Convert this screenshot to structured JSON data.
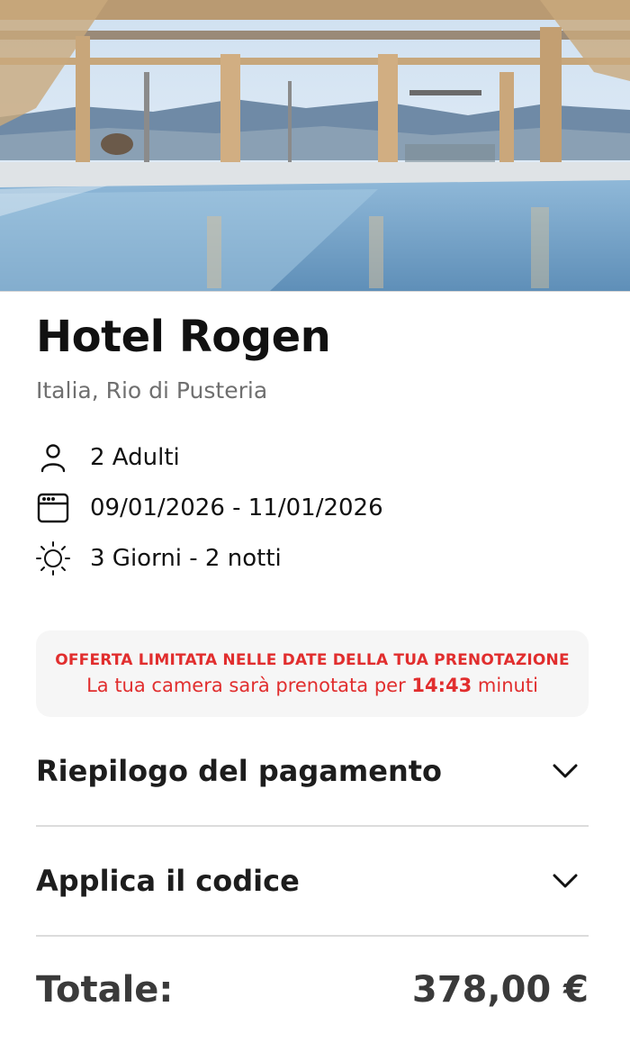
{
  "hotel": {
    "name": "Hotel Rogen",
    "location": "Italia, Rio di Pusteria"
  },
  "details": {
    "guests": "2 Adulti",
    "dates": "09/01/2026 - 11/01/2026",
    "duration": "3 Giorni - 2 notti"
  },
  "offer": {
    "headline": "OFFERTA LIMITATA NELLE DATE DELLA TUA PRENOTAZIONE",
    "text_before": "La tua camera sarà prenotata per ",
    "timer": "14:43",
    "text_after": " minuti"
  },
  "accordions": {
    "payment_summary": "Riepilogo del pagamento",
    "apply_code": "Applica il codice"
  },
  "total": {
    "label": "Totale:",
    "value": "378,00 €"
  },
  "icons": {
    "guests": "person-icon",
    "dates": "calendar-icon",
    "duration": "sun-icon",
    "expand": "chevron-down-icon"
  },
  "colors": {
    "accent": "#e12e2e",
    "panel": "#f6f6f6"
  }
}
